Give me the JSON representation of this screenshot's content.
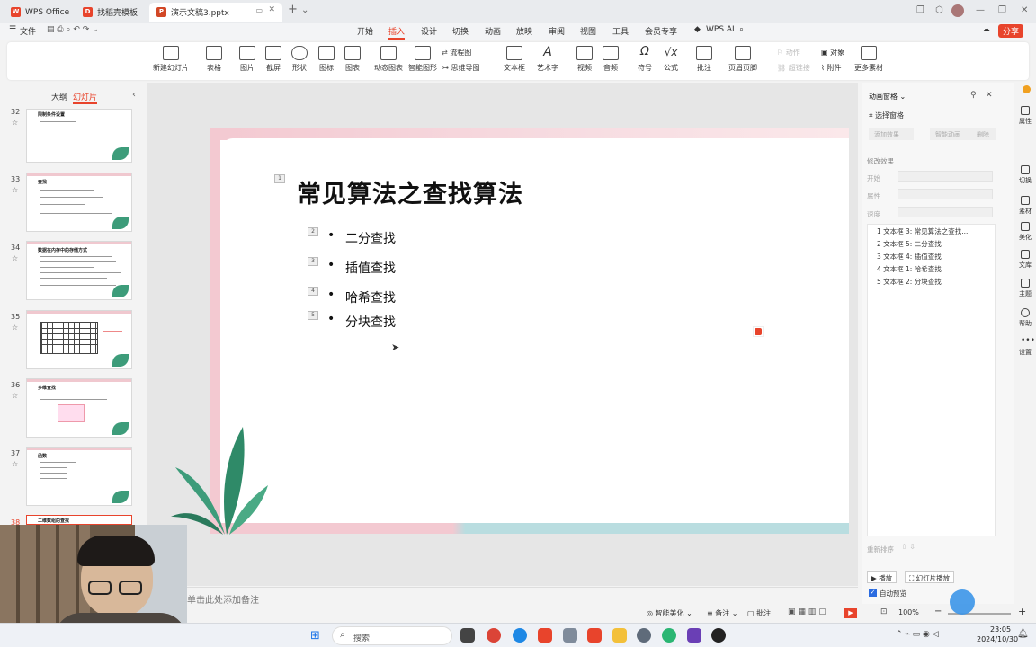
{
  "tabs": [
    {
      "label": "WPS Office"
    },
    {
      "label": "找稻壳模板"
    },
    {
      "label": "演示文稿3.pptx"
    }
  ],
  "menu": {
    "file": "文件",
    "items": [
      "开始",
      "插入",
      "设计",
      "切换",
      "动画",
      "放映",
      "审阅",
      "视图",
      "工具",
      "会员专享"
    ],
    "ai": "WPS AI",
    "share": "分享"
  },
  "ribbon": [
    {
      "label": "新建幻灯片"
    },
    {
      "label": "表格"
    },
    {
      "label": "图片"
    },
    {
      "label": "截屏"
    },
    {
      "label": "形状"
    },
    {
      "label": "图标"
    },
    {
      "label": "图表"
    },
    {
      "label": "动态图表"
    },
    {
      "label": "智能图形"
    },
    {
      "label": "流程图"
    },
    {
      "label": "思维导图"
    },
    {
      "label": "文本框"
    },
    {
      "label": "艺术字"
    },
    {
      "label": "视频"
    },
    {
      "label": "音频"
    },
    {
      "label": "符号"
    },
    {
      "label": "公式"
    },
    {
      "label": "批注"
    },
    {
      "label": "页眉页脚"
    },
    {
      "label": "动作"
    },
    {
      "label": "超链接"
    },
    {
      "label": "对象"
    },
    {
      "label": "附件"
    },
    {
      "label": "更多素材"
    }
  ],
  "left_panel": {
    "tab_outline": "大纲",
    "tab_slides": "幻灯片",
    "slides": [
      {
        "num": "32",
        "title": "限制条件设置"
      },
      {
        "num": "33",
        "title": "查找"
      },
      {
        "num": "34",
        "title": "数据在内存中的存储方式"
      },
      {
        "num": "35",
        "title": ""
      },
      {
        "num": "36",
        "title": "多维查找"
      },
      {
        "num": "37",
        "title": "函数"
      },
      {
        "num": "38",
        "title": "二维数组的查找"
      }
    ]
  },
  "slide": {
    "title": "常见算法之查找算法",
    "title_tag": "1",
    "bullets": [
      {
        "tag": "2",
        "text": "二分查找"
      },
      {
        "tag": "3",
        "text": "插值查找"
      },
      {
        "tag": "4",
        "text": "哈希查找"
      },
      {
        "tag": "5",
        "text": "分块查找"
      }
    ]
  },
  "notes_placeholder": "单击此处添加备注",
  "right_panel": {
    "title": "动画窗格",
    "select_pane": "选择窗格",
    "add_effect": "添加效果",
    "smart_anim": "智能动画",
    "delete": "删除",
    "modify": "修改效果",
    "start": "开始",
    "property": "属性",
    "speed": "速度",
    "items": [
      "1 文本框 3: 常见算法之查找...",
      "2 文本框 5: 二分查找",
      "3 文本框 4: 插值查找",
      "4 文本框 1: 哈希查找",
      "5 文本框 2: 分块查找"
    ],
    "reorder": "重新排序",
    "play": "播放",
    "slideshow": "幻灯片播放",
    "autopreview": "自动预览"
  },
  "right_bar": [
    "属性",
    "切换",
    "素材",
    "美化",
    "文库",
    "主题",
    "帮助",
    "设置"
  ],
  "status": {
    "beautify": "智能美化",
    "notes": "备注",
    "comments": "批注",
    "zoom": "100%"
  },
  "taskbar": {
    "search": "搜索",
    "time": "23:05",
    "date": "2024/10/30"
  }
}
